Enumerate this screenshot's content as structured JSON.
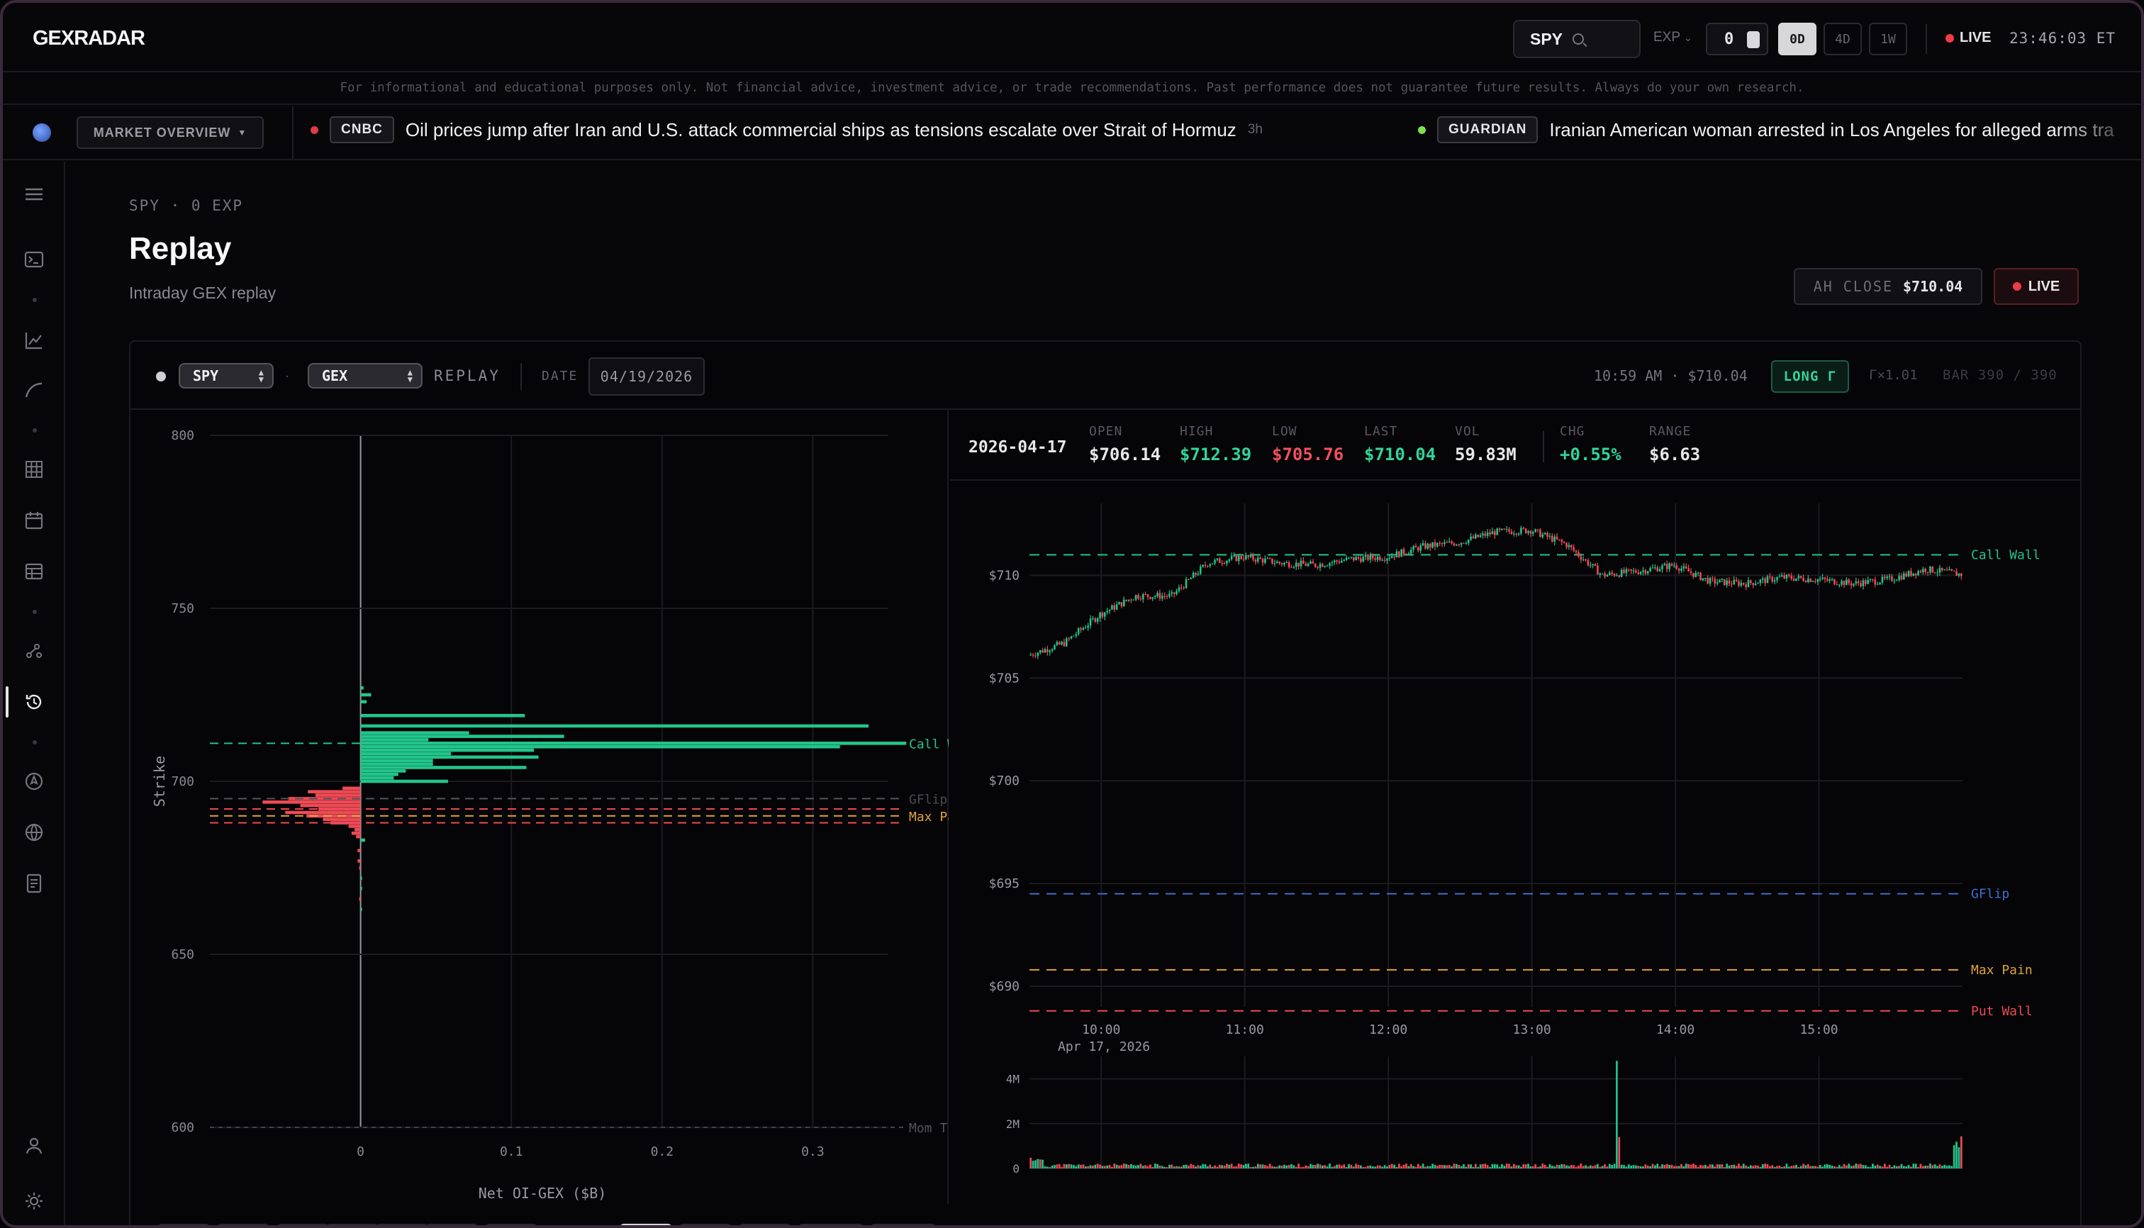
{
  "app": {
    "logo": "GEXRADAR"
  },
  "topbar": {
    "symbol": "SPY",
    "exp_label": "EXP",
    "exp_value": "0",
    "dte_buttons": [
      "0D",
      "4D",
      "1W"
    ],
    "dte_active": "0D",
    "live_label": "LIVE",
    "clock": "23:46:03 ET"
  },
  "disclaimer": "For informational and educational purposes only. Not financial advice, investment advice, or trade recommendations. Past performance does not guarantee future results. Always do your own research.",
  "ticker": {
    "market_button": "MARKET OVERVIEW",
    "items": [
      {
        "source": "CNBC",
        "headline": "Oil prices jump after Iran and U.S. attack commercial ships as tensions escalate over Strait of Hormuz",
        "age": "3h",
        "dot_color": "#e13a44"
      },
      {
        "source": "GUARDIAN",
        "headline": "Iranian American woman arrested in Los Angeles for alleged arms tra",
        "age": "",
        "dot_color": "#7ee04f"
      }
    ]
  },
  "sidebar": {
    "icons": [
      "menu-icon",
      "terminal-icon",
      "line-chart-icon",
      "curve-icon",
      "grid-icon",
      "calendar-icon",
      "table-icon",
      "scatter-icon",
      "replay-icon",
      "compass-icon",
      "globe-icon",
      "document-icon",
      "user-icon",
      "settings-icon"
    ],
    "active": "replay-icon"
  },
  "page": {
    "breadcrumb": "SPY · 0 EXP",
    "title": "Replay",
    "subtitle": "Intraday GEX replay",
    "ah_close_label": "AH CLOSE",
    "ah_close_value": "$710.04",
    "live_button": "LIVE"
  },
  "controls": {
    "symbol_select": "SPY",
    "mode_select": "GEX",
    "replay_label": "REPLAY",
    "date_label": "DATE",
    "date_value": "04/19/2026",
    "status": "10:59 AM · $710.04",
    "regime": "LONG Γ",
    "gamma_mult": "Γ×1.01",
    "bar_counter": "BAR 390 / 390"
  },
  "stats": {
    "date": "2026-04-17",
    "items": [
      {
        "label": "OPEN",
        "value": "$706.14",
        "color": "#e6e6e9"
      },
      {
        "label": "HIGH",
        "value": "$712.39",
        "color": "#2fd49a"
      },
      {
        "label": "LOW",
        "value": "$705.76",
        "color": "#f0515c"
      },
      {
        "label": "LAST",
        "value": "$710.04",
        "color": "#2fd49a"
      },
      {
        "label": "VOL",
        "value": "59.83M",
        "color": "#e6e6e9"
      },
      {
        "label": "CHG",
        "value": "+0.55%",
        "color": "#2fd49a"
      },
      {
        "label": "RANGE",
        "value": "$6.63",
        "color": "#e6e6e9"
      }
    ]
  },
  "colors": {
    "green": "#22c58b",
    "red": "#ee4a55",
    "orange": "#e0a33b",
    "blue": "#3e6fd0",
    "grid": "#1c1b20"
  },
  "chart_data": [
    {
      "type": "bar",
      "orientation": "horizontal",
      "xlabel": "Net OI-GEX ($B)",
      "ylabel": "Strike",
      "xlim": [
        -0.1,
        0.36
      ],
      "ylim": [
        600,
        800
      ],
      "x_ticks": [
        "0",
        "0.1",
        "0.2",
        "0.3"
      ],
      "y_ticks": [
        "600",
        "650",
        "700",
        "750",
        "800"
      ],
      "strikes": [
        727,
        725,
        723,
        719,
        716,
        714,
        713,
        712,
        711,
        710,
        709,
        708,
        707,
        706,
        705,
        704,
        703,
        702,
        701,
        700,
        698,
        697,
        696,
        695,
        694,
        693,
        692,
        691,
        690,
        689,
        688,
        687,
        686,
        685,
        684,
        683,
        680,
        677,
        675,
        672,
        669,
        666,
        663
      ],
      "values": [
        0.002,
        0.007,
        0.004,
        0.109,
        0.337,
        0.072,
        0.135,
        0.045,
        0.362,
        0.318,
        0.115,
        0.06,
        0.118,
        0.048,
        0.048,
        0.11,
        0.03,
        0.025,
        0.022,
        0.058,
        -0.012,
        -0.035,
        -0.03,
        -0.048,
        -0.065,
        -0.04,
        -0.028,
        -0.05,
        -0.036,
        -0.025,
        -0.02,
        -0.008,
        -0.004,
        -0.006,
        -0.003,
        0.003,
        -0.002,
        -0.002,
        -0.001,
        0.001,
        0.001,
        -0.001,
        0.001
      ],
      "levels": [
        {
          "name": "Call Wall",
          "value": 711
        },
        {
          "name": "GFlip",
          "value": 695
        },
        {
          "name": "Max Pain",
          "value": 690
        },
        {
          "name": "Mom Trigger",
          "value": 600
        }
      ]
    },
    {
      "type": "line",
      "title": "",
      "x_ticks": [
        "10:00",
        "11:00",
        "12:00",
        "13:00",
        "14:00",
        "15:00"
      ],
      "x_date_label": "Apr 17, 2026",
      "y_ticks": [
        "$690",
        "$695",
        "$700",
        "$705",
        "$710"
      ],
      "ylim": [
        689,
        713.5
      ],
      "x": [
        "09:30",
        "09:45",
        "10:00",
        "10:15",
        "10:30",
        "10:45",
        "11:00",
        "11:15",
        "11:30",
        "11:45",
        "12:00",
        "12:15",
        "12:30",
        "12:45",
        "13:00",
        "13:15",
        "13:30",
        "13:45",
        "14:00",
        "14:15",
        "14:30",
        "14:45",
        "15:00",
        "15:15",
        "15:30",
        "15:45",
        "16:00"
      ],
      "close": [
        706.1,
        706.7,
        708.1,
        709.0,
        709.0,
        710.6,
        710.9,
        710.6,
        710.5,
        710.8,
        710.9,
        711.4,
        711.6,
        712.1,
        712.2,
        711.5,
        710.0,
        710.2,
        710.5,
        709.7,
        709.6,
        709.9,
        709.8,
        709.6,
        709.8,
        710.3,
        710.04
      ],
      "levels": [
        {
          "name": "Call Wall",
          "value": 711
        },
        {
          "name": "GFlip",
          "value": 694.5
        },
        {
          "name": "Max Pain",
          "value": 690.8
        },
        {
          "name": "Put Wall",
          "value": 688.8
        }
      ],
      "volume_ticks": [
        "0",
        "2M",
        "4M"
      ],
      "volume_ylim": [
        0,
        5000000
      ]
    }
  ]
}
